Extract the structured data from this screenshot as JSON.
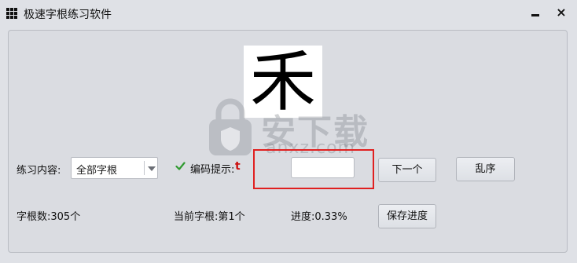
{
  "window": {
    "title": "极速字根练习软件",
    "close_glyph": "×"
  },
  "icons": {
    "app": "grid-icon",
    "minimize": "minimize-icon",
    "close": "close-icon",
    "check": "checkmark-icon",
    "dropdown": "chevron-down-icon",
    "watermark": "lock-shield-icon"
  },
  "colors": {
    "hint_letter": "#cc1111",
    "highlight_frame": "#e02020",
    "check": "#2f9a2f"
  },
  "display": {
    "current_char": "禾"
  },
  "watermark": {
    "main": "安下载",
    "sub": "anxz.com"
  },
  "controls": {
    "content_label": "练习内容:",
    "content_selected": "全部字根",
    "hint_label": "编码提示:",
    "hint_value": "t",
    "answer_value": "",
    "next_label": "下一个",
    "shuffle_label": "乱序",
    "save_label": "保存进度"
  },
  "status": {
    "root_count": "字根数:305个",
    "current_root": "当前字根:第1个",
    "progress": "进度:0.33%"
  }
}
